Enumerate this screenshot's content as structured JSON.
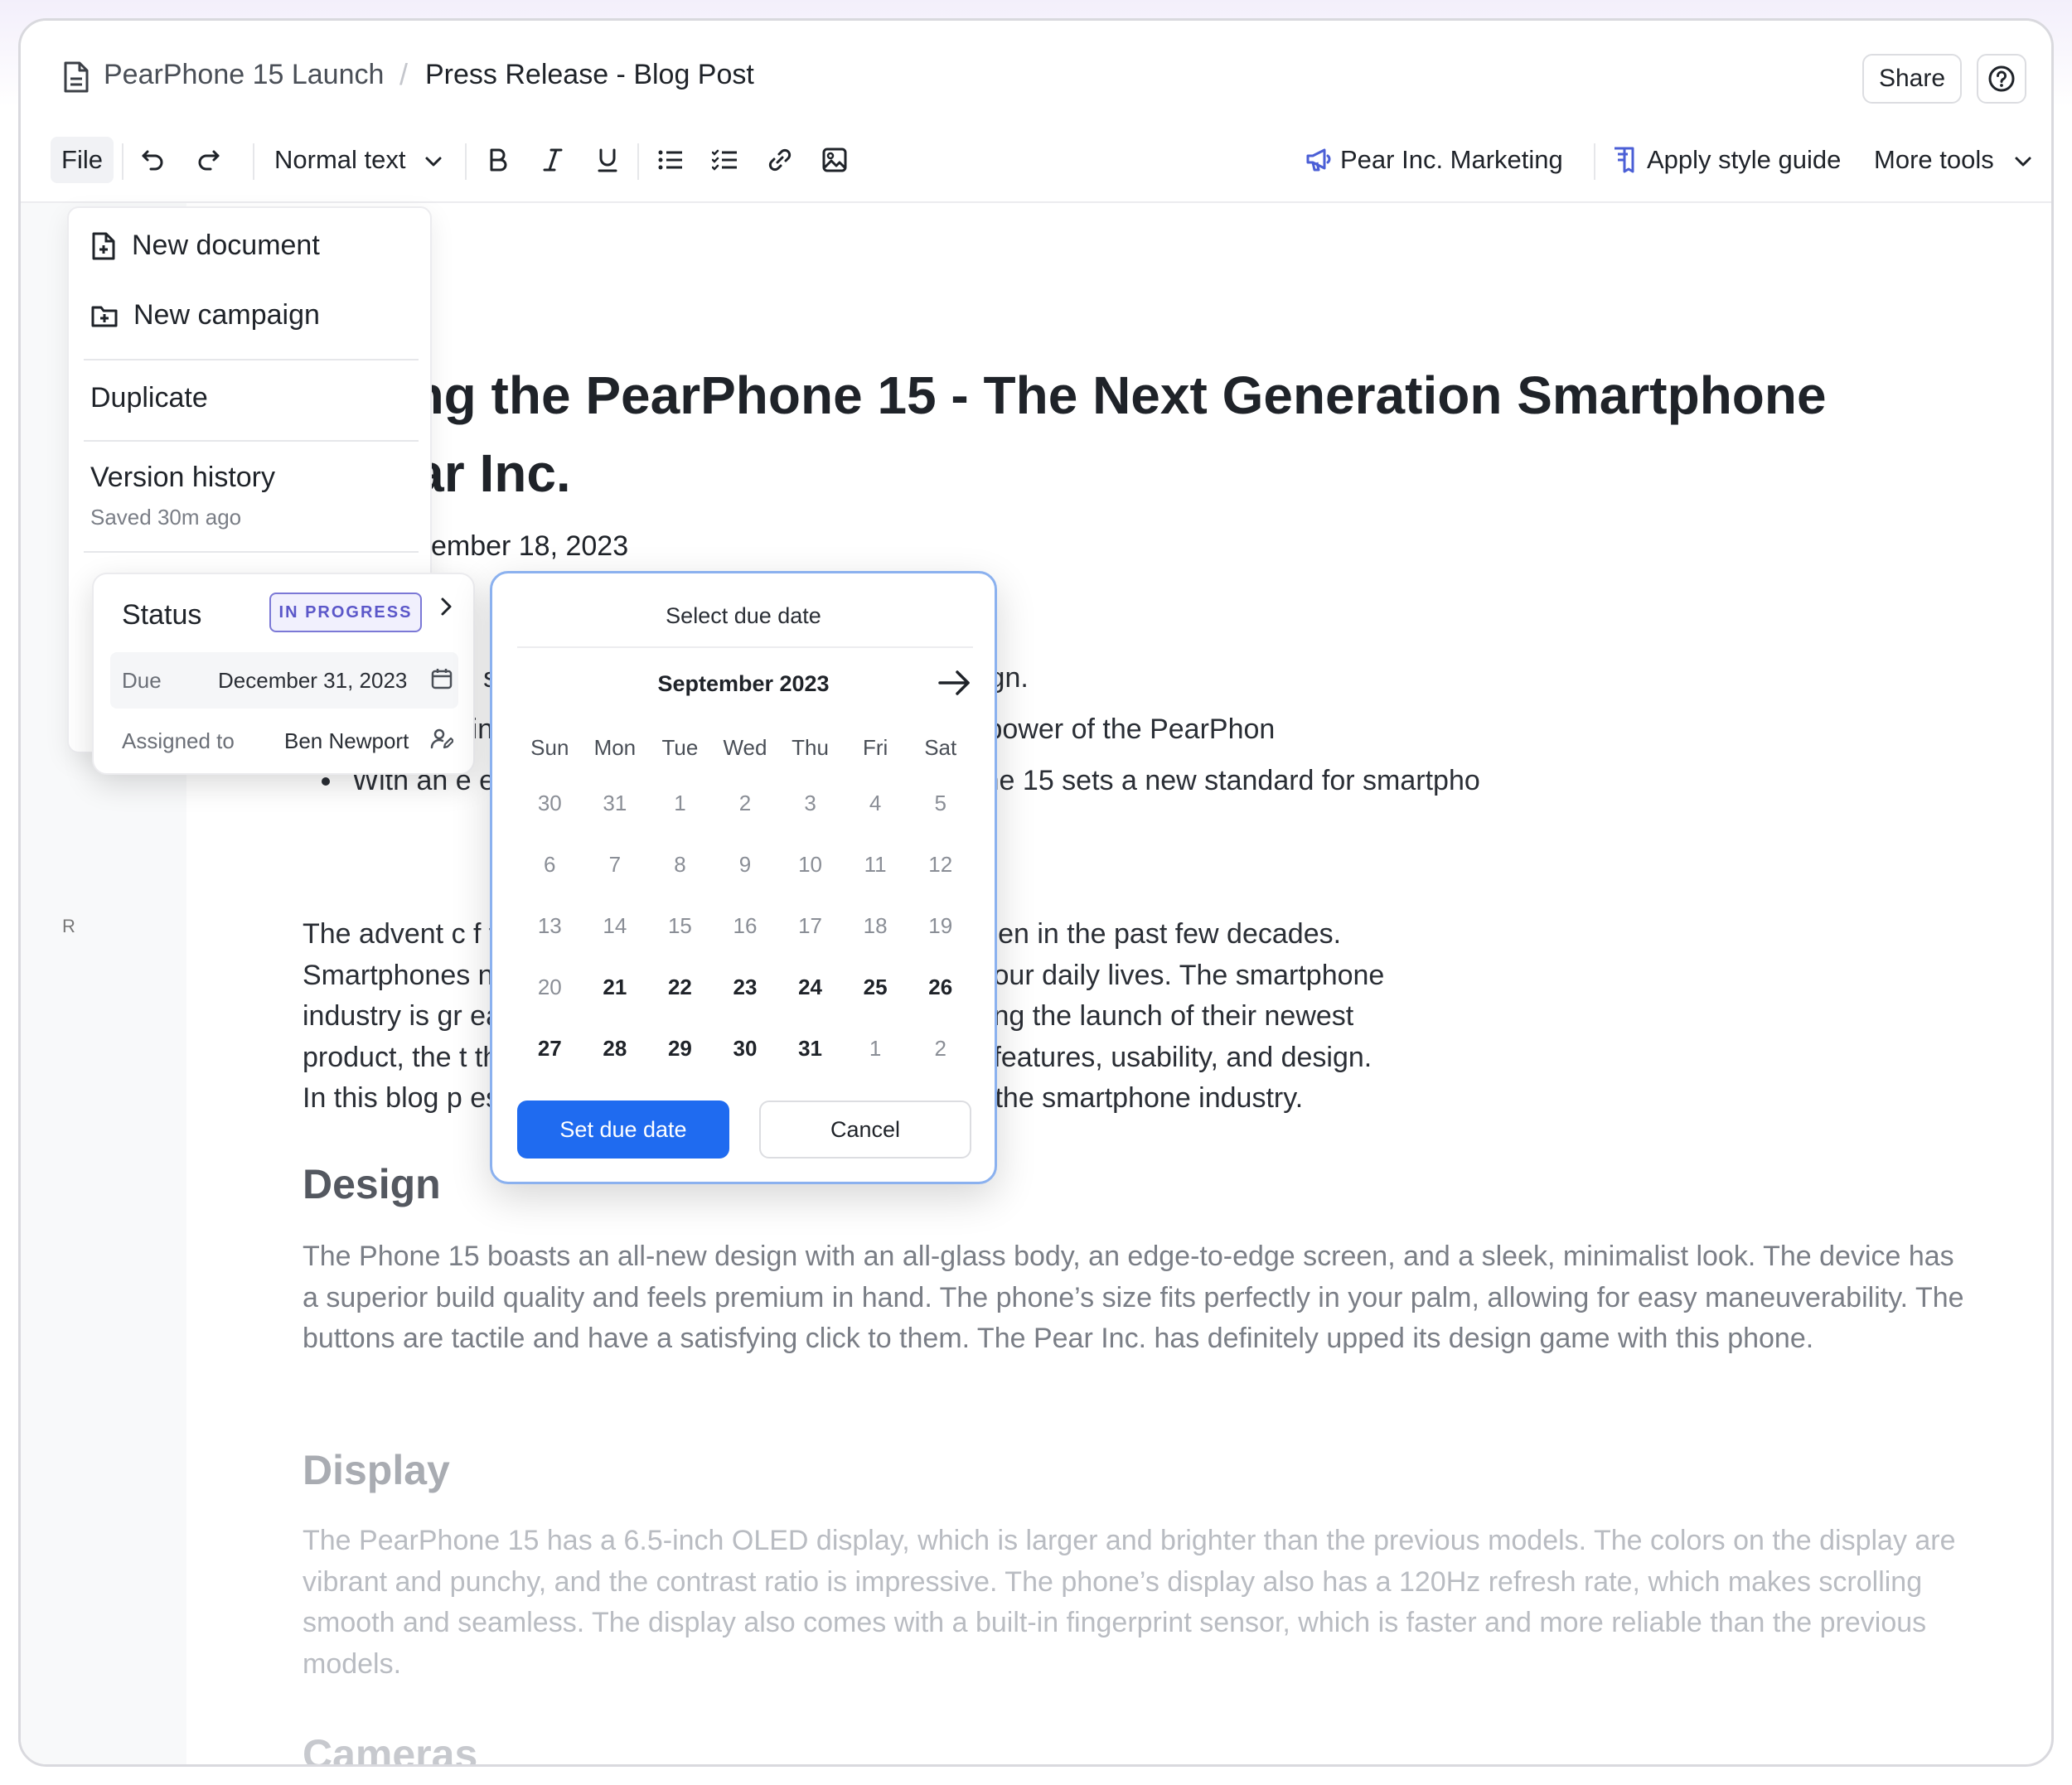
{
  "breadcrumb": {
    "project": "PearPhone 15 Launch",
    "separator": "/",
    "document": "Press Release - Blog Post"
  },
  "header": {
    "share_label": "Share"
  },
  "toolbar": {
    "file_label": "File",
    "text_style": "Normal text",
    "brand_label": "Pear Inc. Marketing",
    "style_guide_label": "Apply style guide",
    "more_tools_label": "More tools"
  },
  "file_menu": {
    "new_document": "New document",
    "new_campaign": "New campaign",
    "duplicate": "Duplicate",
    "version_history": "Version history",
    "saved_text": "Saved 30m ago"
  },
  "status_card": {
    "title": "Status",
    "badge": "IN PROGRESS",
    "due_label": "Due",
    "due_value": "December 31, 2023",
    "assigned_label": "Assigned to",
    "assigned_value": "Ben Newport"
  },
  "date_picker": {
    "title": "Select due date",
    "month": "September 2023",
    "weekdays": [
      "Sun",
      "Mon",
      "Tue",
      "Wed",
      "Thu",
      "Fri",
      "Sat"
    ],
    "days": [
      {
        "d": "30",
        "bold": false
      },
      {
        "d": "31",
        "bold": false
      },
      {
        "d": "1",
        "bold": false
      },
      {
        "d": "2",
        "bold": false
      },
      {
        "d": "3",
        "bold": false
      },
      {
        "d": "4",
        "bold": false
      },
      {
        "d": "5",
        "bold": false
      },
      {
        "d": "6",
        "bold": false
      },
      {
        "d": "7",
        "bold": false
      },
      {
        "d": "8",
        "bold": false
      },
      {
        "d": "9",
        "bold": false
      },
      {
        "d": "10",
        "bold": false
      },
      {
        "d": "11",
        "bold": false
      },
      {
        "d": "12",
        "bold": false
      },
      {
        "d": "13",
        "bold": false
      },
      {
        "d": "14",
        "bold": false
      },
      {
        "d": "15",
        "bold": false
      },
      {
        "d": "16",
        "bold": false
      },
      {
        "d": "17",
        "bold": false
      },
      {
        "d": "18",
        "bold": false
      },
      {
        "d": "19",
        "bold": false
      },
      {
        "d": "20",
        "bold": false
      },
      {
        "d": "21",
        "bold": true
      },
      {
        "d": "22",
        "bold": true
      },
      {
        "d": "23",
        "bold": true
      },
      {
        "d": "24",
        "bold": true
      },
      {
        "d": "25",
        "bold": true
      },
      {
        "d": "26",
        "bold": true
      },
      {
        "d": "27",
        "bold": true
      },
      {
        "d": "28",
        "bold": true
      },
      {
        "d": "29",
        "bold": true
      },
      {
        "d": "30",
        "bold": true
      },
      {
        "d": "31",
        "bold": true
      },
      {
        "d": "1",
        "bold": false
      },
      {
        "d": "2",
        "bold": false
      }
    ],
    "set_label": "Set due date",
    "cancel_label": "Cancel"
  },
  "gutter": {
    "letter": "R"
  },
  "document": {
    "title": "ducing the PearPhone 15 - The Next Generation Smartphone n Pear Inc.",
    "title_line1": "ducing the PearPhone 15 - The Next Generation Smartphone",
    "title_line2": "n Pear Inc.",
    "byline": "Inc. · September 18, 2023",
    "section_fragment": "a",
    "bullets": [
      "-P gy with state-of-the-art features and a sleek design.",
      "artphone innovation with the advanced processing power of the PearPhon",
      "With an e eaking camera capabilities, the PearPhone 15 sets a new standard for smartpho"
    ],
    "intro_lines": [
      "The advent c f the most significant innovations we’ve seen in the past few decades.",
      "Smartphones ns that have become an essential part of our daily lives. The smartphone",
      "industry is gr ear Inc. has taken the plunge by announcing the launch of their newest",
      "product, the t this phone is a game-changer in terms of features, usability, and design.",
      "In this blog p es the PearPhone 15 the next big thing in the smartphone industry."
    ],
    "design_heading": "Design",
    "design_text": "The Phone 15 boasts an all-new design with an all-glass body, an edge-to-edge screen, and a sleek, minimalist look. The device has a superior build quality and feels premium in hand. The phone’s size fits perfectly in your palm, allowing for easy maneuverability. The buttons are tactile and have a satisfying click to them. The Pear Inc. has definitely upped its design game with this phone.",
    "display_heading": "Display",
    "display_text": "The PearPhone 15 has a 6.5-inch OLED display, which is larger and brighter than the previous models. The colors on the display are vibrant and punchy, and the contrast ratio is impressive. The phone’s display also has a 120Hz refresh rate, which makes scrolling smooth and seamless. The display also comes with a built-in fingerprint sensor, which is faster and more reliable than the previous models.",
    "cameras_heading": "Cameras"
  },
  "colors": {
    "accent": "#1f6bf0",
    "badge": "#5b57c9",
    "picker_border": "#8bb1ef"
  }
}
